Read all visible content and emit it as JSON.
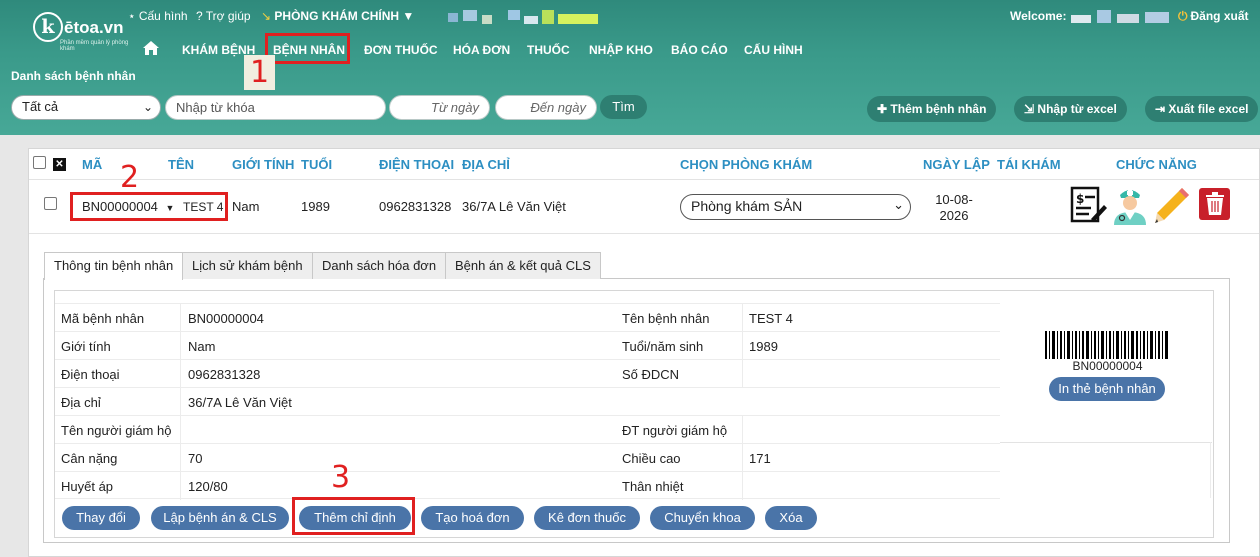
{
  "app": {
    "logo_letter": "k",
    "logo_text": "ētoa.vn",
    "logo_sub": "Phần mềm quản lý phòng khám"
  },
  "header": {
    "config_link": "⋆ Cấu hình",
    "help_link": "? Trợ giúp",
    "clinic_menu": "PHÒNG KHÁM CHÍNH",
    "welcome_label": "Welcome:",
    "logout_label": "Đăng xuất"
  },
  "nav": {
    "items": [
      "KHÁM BỆNH",
      "BỆNH NHÂN",
      "ĐƠN THUỐC",
      "HÓA ĐƠN",
      "THUỐC",
      "NHẬP KHO",
      "BÁO CÁO",
      "CẤU HÌNH"
    ]
  },
  "page_title": "Danh sách bệnh nhân",
  "filters": {
    "status_value": "Tất cả",
    "keyword_placeholder": "Nhập từ khóa",
    "from_date_placeholder": "Từ ngày",
    "to_date_placeholder": "Đến ngày",
    "search_label": "Tìm"
  },
  "actions": {
    "add_patient": "Thêm bệnh nhân",
    "import_excel": "Nhập từ excel",
    "export_excel": "Xuất file excel"
  },
  "table": {
    "headers": [
      "MÃ",
      "TÊN",
      "GIỚI TÍNH",
      "TUỔI",
      "ĐIỆN THOẠI",
      "ĐỊA CHỈ",
      "CHỌN PHÒNG KHÁM",
      "NGÀY LẬP",
      "TÁI KHÁM",
      "CHỨC NĂNG"
    ],
    "row": {
      "code": "BN00000004",
      "name": "TEST 4",
      "gender": "Nam",
      "age": "1989",
      "phone": "0962831328",
      "address": "36/7A Lê Văn Việt",
      "clinic": "Phòng khám SẢN",
      "date_line1": "10-08-",
      "date_line2": "2026"
    }
  },
  "tabs": [
    "Thông tin bệnh nhân",
    "Lịch sử khám bệnh",
    "Danh sách hóa đơn",
    "Bệnh án & kết quả CLS"
  ],
  "details": {
    "rows": [
      {
        "l1": "Mã bệnh nhân",
        "v1": "BN00000004",
        "l2": "Tên bệnh nhân",
        "v2": "TEST 4"
      },
      {
        "l1": "Giới tính",
        "v1": "Nam",
        "l2": "Tuổi/năm sinh",
        "v2": "1989"
      },
      {
        "l1": "Điện thoại",
        "v1": "0962831328",
        "l2": "Số ĐDCN",
        "v2": ""
      },
      {
        "l1": "Địa chỉ",
        "v1": "36/7A Lê Văn Việt",
        "l2": "",
        "v2": ""
      },
      {
        "l1": "Tên người giám hộ",
        "v1": "",
        "l2": "ĐT người giám hộ",
        "v2": ""
      },
      {
        "l1": "Cân nặng",
        "v1": "70",
        "l2": "Chiều cao",
        "v2": "171"
      },
      {
        "l1": "Huyết áp",
        "v1": "120/80",
        "l2": "Thân nhiệt",
        "v2": ""
      }
    ],
    "barcode_text": "BN00000004",
    "print_card": "In thẻ bệnh nhân"
  },
  "bottom_buttons": [
    "Thay đổi",
    "Lập bệnh án & CLS",
    "Thêm chỉ định",
    "Tạo hoá đơn",
    "Kê đơn thuốc",
    "Chuyển khoa",
    "Xóa"
  ],
  "callouts": [
    "1",
    "2",
    "3"
  ],
  "colors": {
    "header": "#3a9a8a",
    "accent_dark": "#2e7f72",
    "blue_button": "#4a74a8",
    "header_text": "#2d8fc2",
    "callout": "#e02020"
  }
}
